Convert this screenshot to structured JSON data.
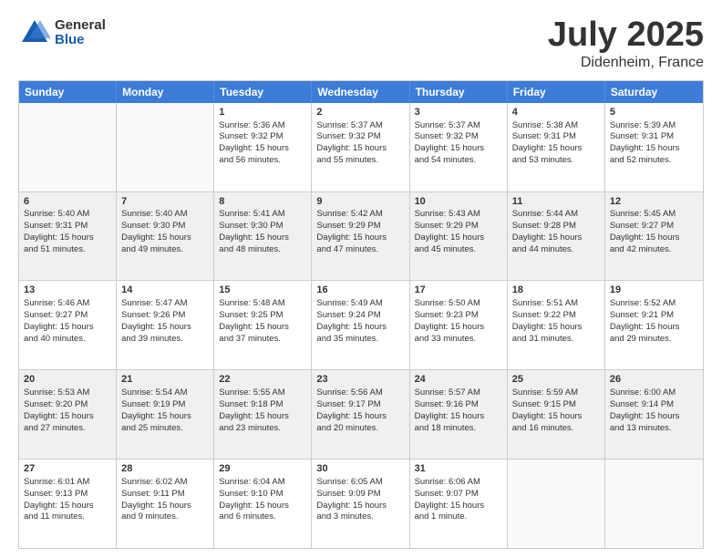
{
  "header": {
    "logo": {
      "general": "General",
      "blue": "Blue"
    },
    "title": "July 2025",
    "subtitle": "Didenheim, France"
  },
  "weekdays": [
    "Sunday",
    "Monday",
    "Tuesday",
    "Wednesday",
    "Thursday",
    "Friday",
    "Saturday"
  ],
  "rows": [
    [
      {
        "day": "",
        "empty": true
      },
      {
        "day": "",
        "empty": true
      },
      {
        "day": "1",
        "line1": "Sunrise: 5:36 AM",
        "line2": "Sunset: 9:32 PM",
        "line3": "Daylight: 15 hours",
        "line4": "and 56 minutes."
      },
      {
        "day": "2",
        "line1": "Sunrise: 5:37 AM",
        "line2": "Sunset: 9:32 PM",
        "line3": "Daylight: 15 hours",
        "line4": "and 55 minutes."
      },
      {
        "day": "3",
        "line1": "Sunrise: 5:37 AM",
        "line2": "Sunset: 9:32 PM",
        "line3": "Daylight: 15 hours",
        "line4": "and 54 minutes."
      },
      {
        "day": "4",
        "line1": "Sunrise: 5:38 AM",
        "line2": "Sunset: 9:31 PM",
        "line3": "Daylight: 15 hours",
        "line4": "and 53 minutes."
      },
      {
        "day": "5",
        "line1": "Sunrise: 5:39 AM",
        "line2": "Sunset: 9:31 PM",
        "line3": "Daylight: 15 hours",
        "line4": "and 52 minutes."
      }
    ],
    [
      {
        "day": "6",
        "line1": "Sunrise: 5:40 AM",
        "line2": "Sunset: 9:31 PM",
        "line3": "Daylight: 15 hours",
        "line4": "and 51 minutes."
      },
      {
        "day": "7",
        "line1": "Sunrise: 5:40 AM",
        "line2": "Sunset: 9:30 PM",
        "line3": "Daylight: 15 hours",
        "line4": "and 49 minutes."
      },
      {
        "day": "8",
        "line1": "Sunrise: 5:41 AM",
        "line2": "Sunset: 9:30 PM",
        "line3": "Daylight: 15 hours",
        "line4": "and 48 minutes."
      },
      {
        "day": "9",
        "line1": "Sunrise: 5:42 AM",
        "line2": "Sunset: 9:29 PM",
        "line3": "Daylight: 15 hours",
        "line4": "and 47 minutes."
      },
      {
        "day": "10",
        "line1": "Sunrise: 5:43 AM",
        "line2": "Sunset: 9:29 PM",
        "line3": "Daylight: 15 hours",
        "line4": "and 45 minutes."
      },
      {
        "day": "11",
        "line1": "Sunrise: 5:44 AM",
        "line2": "Sunset: 9:28 PM",
        "line3": "Daylight: 15 hours",
        "line4": "and 44 minutes."
      },
      {
        "day": "12",
        "line1": "Sunrise: 5:45 AM",
        "line2": "Sunset: 9:27 PM",
        "line3": "Daylight: 15 hours",
        "line4": "and 42 minutes."
      }
    ],
    [
      {
        "day": "13",
        "line1": "Sunrise: 5:46 AM",
        "line2": "Sunset: 9:27 PM",
        "line3": "Daylight: 15 hours",
        "line4": "and 40 minutes."
      },
      {
        "day": "14",
        "line1": "Sunrise: 5:47 AM",
        "line2": "Sunset: 9:26 PM",
        "line3": "Daylight: 15 hours",
        "line4": "and 39 minutes."
      },
      {
        "day": "15",
        "line1": "Sunrise: 5:48 AM",
        "line2": "Sunset: 9:25 PM",
        "line3": "Daylight: 15 hours",
        "line4": "and 37 minutes."
      },
      {
        "day": "16",
        "line1": "Sunrise: 5:49 AM",
        "line2": "Sunset: 9:24 PM",
        "line3": "Daylight: 15 hours",
        "line4": "and 35 minutes."
      },
      {
        "day": "17",
        "line1": "Sunrise: 5:50 AM",
        "line2": "Sunset: 9:23 PM",
        "line3": "Daylight: 15 hours",
        "line4": "and 33 minutes."
      },
      {
        "day": "18",
        "line1": "Sunrise: 5:51 AM",
        "line2": "Sunset: 9:22 PM",
        "line3": "Daylight: 15 hours",
        "line4": "and 31 minutes."
      },
      {
        "day": "19",
        "line1": "Sunrise: 5:52 AM",
        "line2": "Sunset: 9:21 PM",
        "line3": "Daylight: 15 hours",
        "line4": "and 29 minutes."
      }
    ],
    [
      {
        "day": "20",
        "line1": "Sunrise: 5:53 AM",
        "line2": "Sunset: 9:20 PM",
        "line3": "Daylight: 15 hours",
        "line4": "and 27 minutes."
      },
      {
        "day": "21",
        "line1": "Sunrise: 5:54 AM",
        "line2": "Sunset: 9:19 PM",
        "line3": "Daylight: 15 hours",
        "line4": "and 25 minutes."
      },
      {
        "day": "22",
        "line1": "Sunrise: 5:55 AM",
        "line2": "Sunset: 9:18 PM",
        "line3": "Daylight: 15 hours",
        "line4": "and 23 minutes."
      },
      {
        "day": "23",
        "line1": "Sunrise: 5:56 AM",
        "line2": "Sunset: 9:17 PM",
        "line3": "Daylight: 15 hours",
        "line4": "and 20 minutes."
      },
      {
        "day": "24",
        "line1": "Sunrise: 5:57 AM",
        "line2": "Sunset: 9:16 PM",
        "line3": "Daylight: 15 hours",
        "line4": "and 18 minutes."
      },
      {
        "day": "25",
        "line1": "Sunrise: 5:59 AM",
        "line2": "Sunset: 9:15 PM",
        "line3": "Daylight: 15 hours",
        "line4": "and 16 minutes."
      },
      {
        "day": "26",
        "line1": "Sunrise: 6:00 AM",
        "line2": "Sunset: 9:14 PM",
        "line3": "Daylight: 15 hours",
        "line4": "and 13 minutes."
      }
    ],
    [
      {
        "day": "27",
        "line1": "Sunrise: 6:01 AM",
        "line2": "Sunset: 9:13 PM",
        "line3": "Daylight: 15 hours",
        "line4": "and 11 minutes."
      },
      {
        "day": "28",
        "line1": "Sunrise: 6:02 AM",
        "line2": "Sunset: 9:11 PM",
        "line3": "Daylight: 15 hours",
        "line4": "and 9 minutes."
      },
      {
        "day": "29",
        "line1": "Sunrise: 6:04 AM",
        "line2": "Sunset: 9:10 PM",
        "line3": "Daylight: 15 hours",
        "line4": "and 6 minutes."
      },
      {
        "day": "30",
        "line1": "Sunrise: 6:05 AM",
        "line2": "Sunset: 9:09 PM",
        "line3": "Daylight: 15 hours",
        "line4": "and 3 minutes."
      },
      {
        "day": "31",
        "line1": "Sunrise: 6:06 AM",
        "line2": "Sunset: 9:07 PM",
        "line3": "Daylight: 15 hours",
        "line4": "and 1 minute."
      },
      {
        "day": "",
        "empty": true
      },
      {
        "day": "",
        "empty": true
      }
    ]
  ]
}
